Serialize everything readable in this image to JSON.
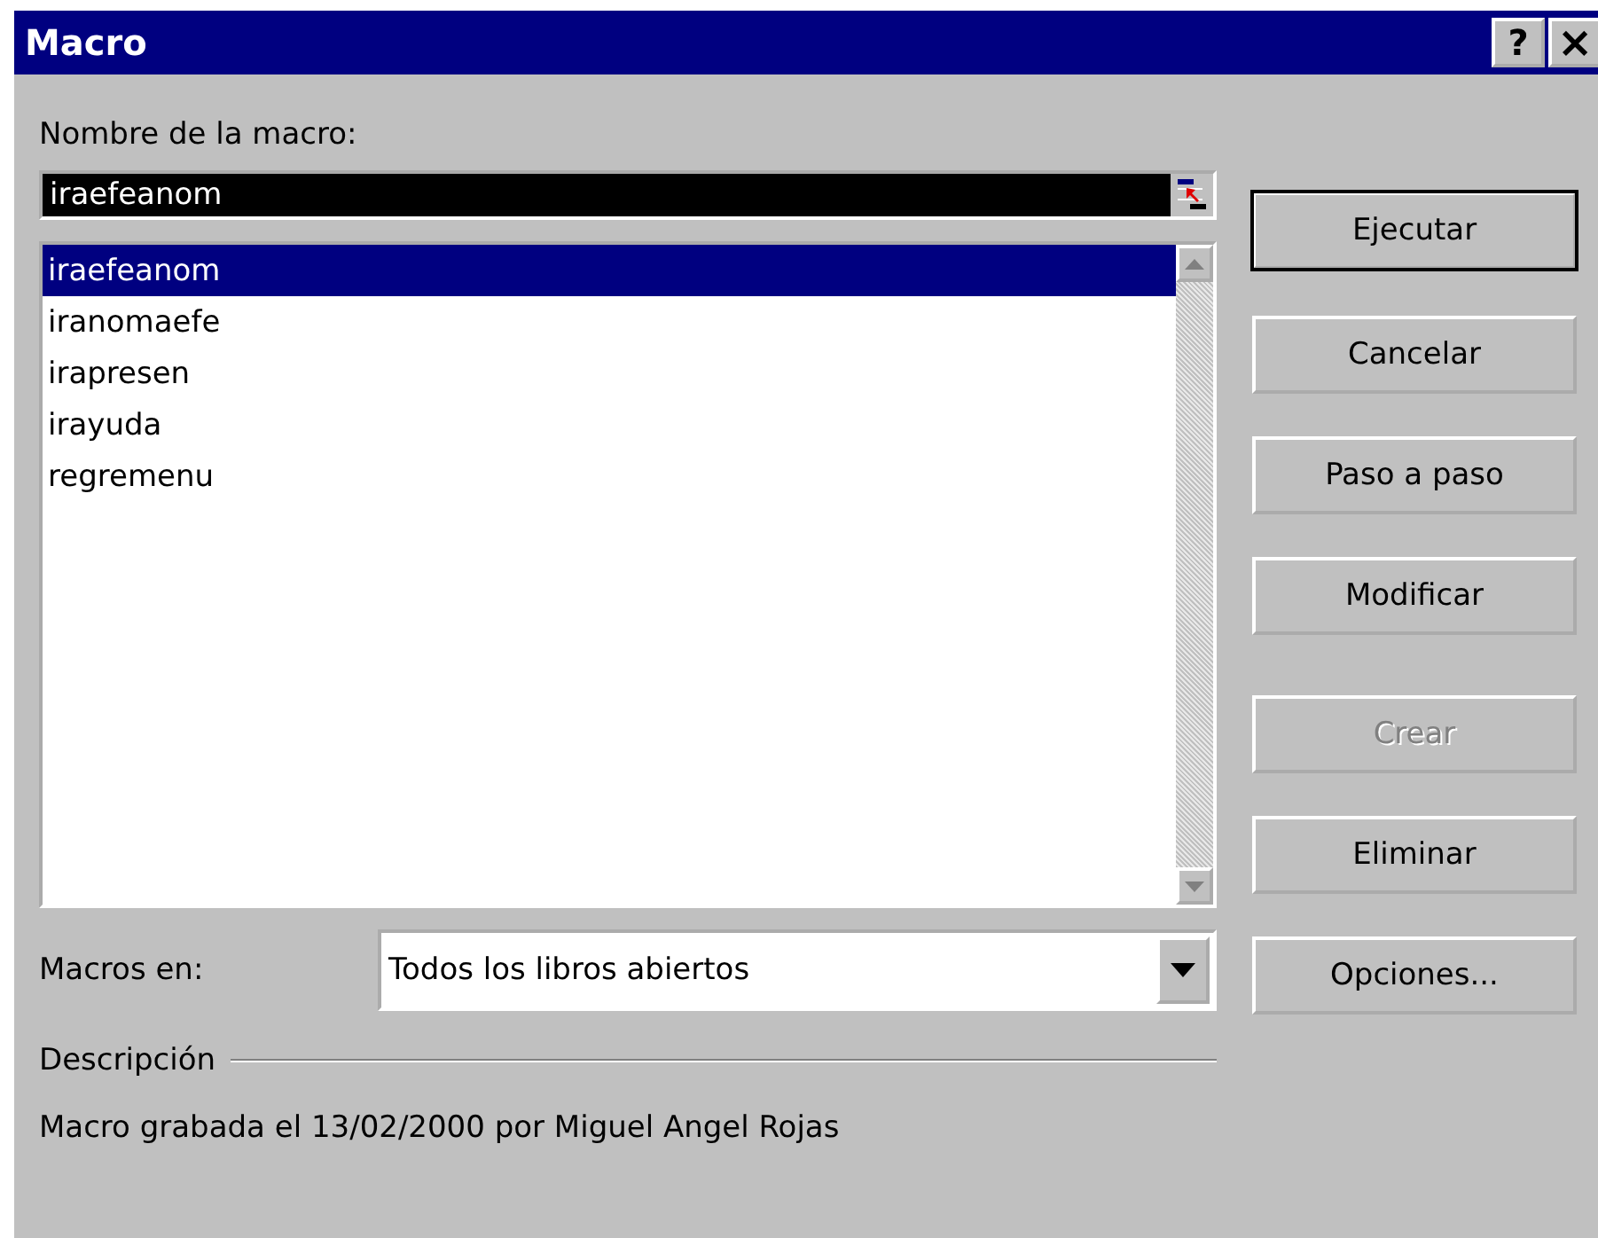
{
  "window": {
    "title": "Macro"
  },
  "title_buttons": [
    {
      "label": "?",
      "kind": "help"
    },
    {
      "label": "×",
      "kind": "close"
    }
  ],
  "name_label": {
    "text": "Nombre de la macro:"
  },
  "name_field": {
    "value": "iraefeanom",
    "selected": true
  },
  "macro_list": [
    {
      "label": "iraefeanom",
      "selected": true
    },
    {
      "label": "iranomaefe",
      "selected": false
    },
    {
      "label": "irapresen",
      "selected": false
    },
    {
      "label": "irayuda",
      "selected": false
    },
    {
      "label": "regremenu",
      "selected": false
    }
  ],
  "macros_in": {
    "label": "Macros en:",
    "value": "Todos los libros abiertos"
  },
  "description": {
    "label": "Descripción",
    "text": "Macro grabada el 13/02/2000 por Miguel Angel Rojas"
  },
  "buttons": [
    {
      "label": "Ejecutar",
      "disabled": false,
      "default": true
    },
    {
      "label": "Cancelar",
      "disabled": false,
      "default": false
    },
    {
      "label": "Paso a paso",
      "disabled": false,
      "default": false
    },
    {
      "label": "Modificar",
      "disabled": false,
      "default": false
    },
    {
      "label": "Crear",
      "disabled": true,
      "default": false
    },
    {
      "label": "Eliminar",
      "disabled": false,
      "default": false
    },
    {
      "label": "Opciones...",
      "disabled": false,
      "default": false
    }
  ]
}
